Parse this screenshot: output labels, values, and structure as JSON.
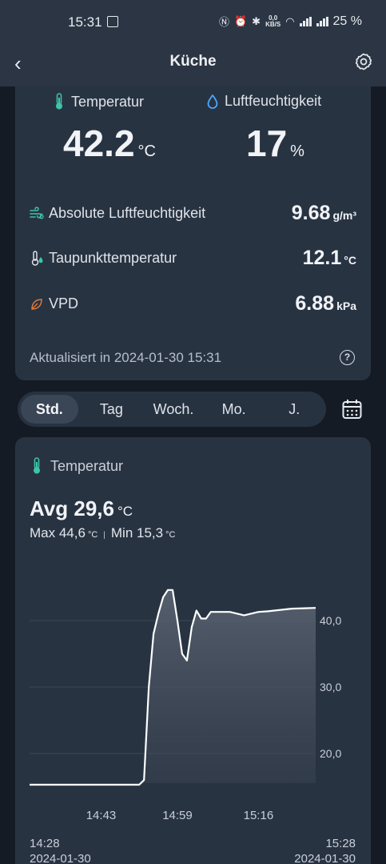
{
  "status": {
    "time": "15:31",
    "battery": "25 %"
  },
  "header": {
    "title": "Küche",
    "back_icon": "chevron-left-icon",
    "settings_icon": "gear-icon"
  },
  "summary": {
    "temperature": {
      "label": "Temperatur",
      "value": "42.2",
      "unit": "°C"
    },
    "humidity": {
      "label": "Luftfeuchtigkeit",
      "value": "17",
      "unit": "%"
    },
    "rows": [
      {
        "label": "Absolute Luftfeuchtigkeit",
        "value": "9.68",
        "unit": "g/m³",
        "icon": "wind-drops-icon"
      },
      {
        "label": "Taupunkttemperatur",
        "value": "12.1",
        "unit": "°C",
        "icon": "dewpoint-icon"
      },
      {
        "label": "VPD",
        "value": "6.88",
        "unit": "kPa",
        "icon": "leaf-icon"
      }
    ],
    "updated": "Aktualisiert in 2024-01-30 15:31"
  },
  "tabs": [
    "Std.",
    "Tag",
    "Woch.",
    "Mo.",
    "J."
  ],
  "active_tab": "Std.",
  "history": {
    "title": "Temperatur",
    "avg_label": "Avg 29,6",
    "avg_unit": "°C",
    "max_label": "Max 44,6",
    "min_label": "Min 15,3",
    "unit": "°C",
    "start_time": "14:28",
    "start_date": "2024-01-30",
    "end_time": "15:28",
    "end_date": "2024-01-30"
  },
  "colors": {
    "accent": "#3fc4a9",
    "humidity": "#4aa8ff",
    "vpd": "#e07b3a"
  },
  "chart_data": {
    "type": "area",
    "x_ticks": [
      "14:43",
      "14:59",
      "15:16"
    ],
    "y_ticks": [
      "20,0",
      "30,0",
      "40,0"
    ],
    "ylim": [
      15,
      45
    ],
    "x_minutes": [
      0,
      5,
      10,
      15,
      20,
      23,
      24,
      25,
      26,
      27,
      28,
      29,
      30,
      31,
      32,
      33,
      34,
      35,
      36,
      37,
      38,
      39,
      40,
      42,
      45,
      48,
      50,
      55,
      60
    ],
    "values": [
      15.3,
      15.3,
      15.3,
      15.3,
      15.3,
      15.3,
      16,
      30,
      38,
      41,
      43.5,
      44.6,
      44.6,
      40,
      35,
      34,
      39,
      41.5,
      40.3,
      40.3,
      41.3,
      41.3,
      41.3,
      41.3,
      40.8,
      41.3,
      41.4,
      41.8,
      41.9
    ]
  }
}
